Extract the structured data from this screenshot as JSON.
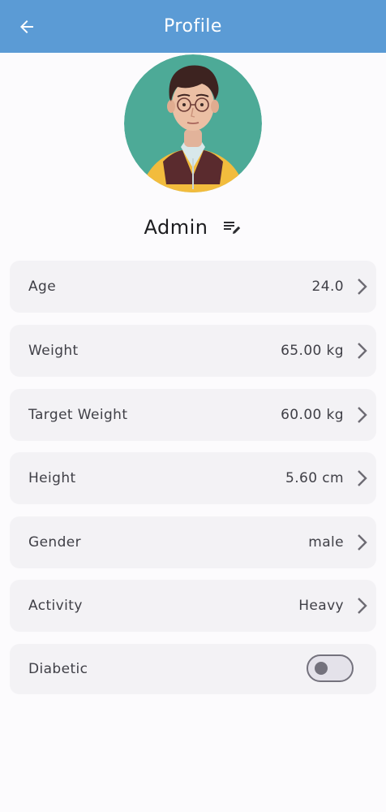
{
  "app_bar": {
    "title": "Profile",
    "back_icon": "arrow-left-icon",
    "color": "#5b9bd5"
  },
  "profile": {
    "name": "Admin",
    "edit_icon": "edit-notes-icon",
    "avatar_icon": "user-avatar-portrait"
  },
  "fields": [
    {
      "label": "Age",
      "value": "24.0"
    },
    {
      "label": "Weight",
      "value": "65.00 kg"
    },
    {
      "label": "Target Weight",
      "value": "60.00 kg"
    },
    {
      "label": "Height",
      "value": "5.60 cm"
    },
    {
      "label": "Gender",
      "value": "male"
    },
    {
      "label": "Activity",
      "value": "Heavy"
    }
  ],
  "diabetic": {
    "label": "Diabetic",
    "enabled": false
  }
}
